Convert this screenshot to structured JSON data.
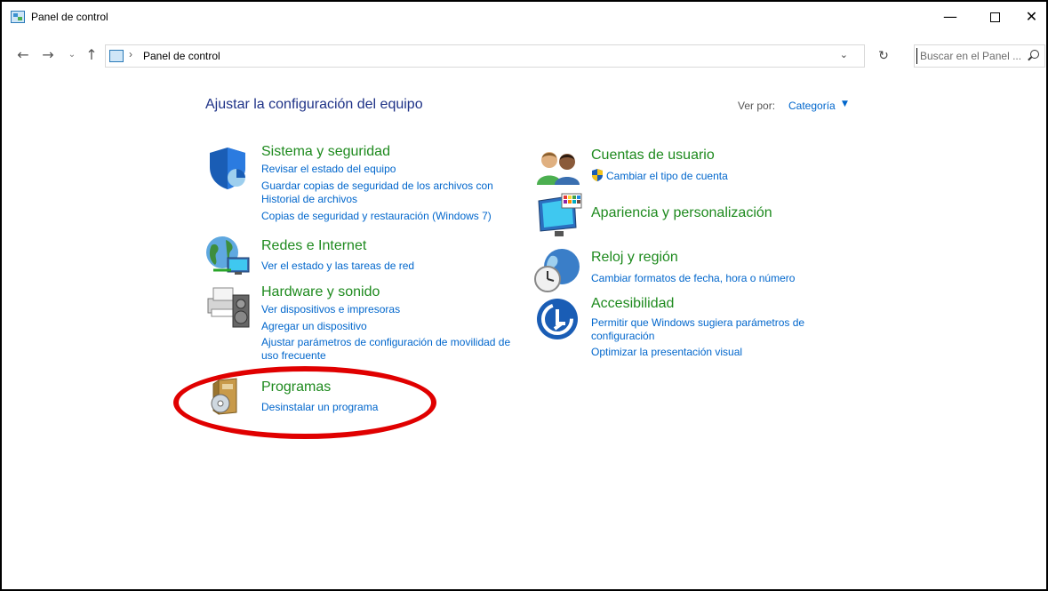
{
  "window": {
    "title": "Panel de control",
    "minimize": "—",
    "close": "✕"
  },
  "nav": {
    "back": "←",
    "forward": "→",
    "recent": "⌄",
    "up": "↑",
    "separator": "›",
    "address": "Panel de control",
    "dropdown": "⌄",
    "refresh": "↻",
    "search_placeholder": "Buscar en el Panel ..."
  },
  "header": {
    "title": "Ajustar la configuración del equipo",
    "view_by_label": "Ver por:",
    "view_by_value": "Categoría",
    "view_by_arrow": "▼"
  },
  "categories": {
    "system": {
      "title": "Sistema y seguridad",
      "links": [
        "Revisar el estado del equipo",
        "Guardar copias de seguridad de los archivos con",
        "Historial de archivos",
        "Copias de seguridad y restauración (Windows 7)"
      ]
    },
    "network": {
      "title": "Redes e Internet",
      "links": [
        "Ver el estado y las tareas de red"
      ]
    },
    "hardware": {
      "title": "Hardware y sonido",
      "links": [
        "Ver dispositivos e impresoras",
        "Agregar un dispositivo",
        "Ajustar parámetros de configuración de movilidad de",
        "uso frecuente"
      ]
    },
    "programs": {
      "title": "Programas",
      "links": [
        "Desinstalar un programa"
      ]
    },
    "accounts": {
      "title": "Cuentas de usuario",
      "links": [
        "Cambiar el tipo de cuenta"
      ]
    },
    "appearance": {
      "title": "Apariencia y personalización",
      "links": []
    },
    "clock": {
      "title": "Reloj y región",
      "links": [
        "Cambiar formatos de fecha, hora o número"
      ]
    },
    "accessibility": {
      "title": "Accesibilidad",
      "links": [
        "Permitir que Windows sugiera parámetros de",
        "configuración",
        "Optimizar la presentación visual"
      ]
    }
  },
  "colors": {
    "category_title": "#1e8a1e",
    "link": "#0066cc",
    "page_title": "#1e3287",
    "highlight": "#e00000"
  },
  "icons": [
    "control-panel-icon",
    "shield-icon",
    "globe-network-icon",
    "printer-speaker-icon",
    "software-box-icon",
    "users-icon",
    "uac-shield-icon",
    "monitor-palette-icon",
    "clock-globe-icon",
    "accessibility-icon",
    "search-icon"
  ]
}
